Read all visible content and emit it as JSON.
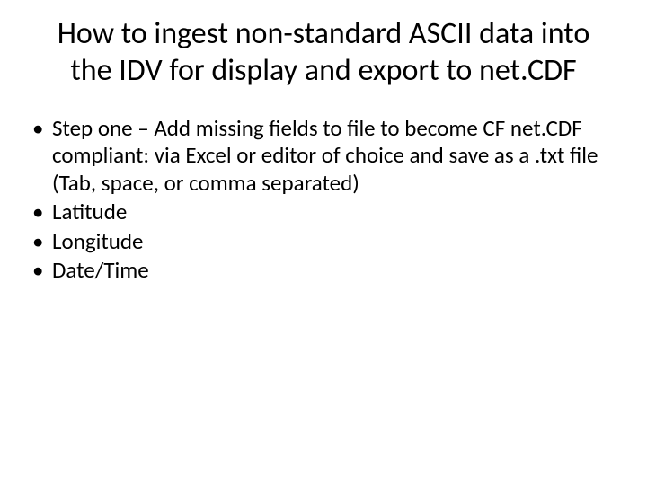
{
  "slide": {
    "title": "How to ingest non-standard ASCII data into the IDV for display and export to net.CDF",
    "bullets": [
      "Step one – Add missing fields to file to become CF net.CDF compliant: via Excel or editor of choice and save as a .txt file (Tab, space, or comma separated)",
      "Latitude",
      "Longitude",
      "Date/Time"
    ]
  }
}
